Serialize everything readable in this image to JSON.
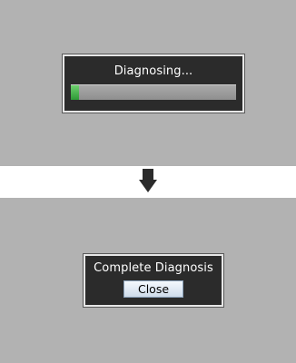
{
  "panels": [
    {
      "title": "Diagnosing...",
      "progress_fraction": 0.05
    },
    {
      "title": "Complete Diagnosis",
      "button_label": "Close"
    }
  ],
  "arrow_icon": "down-arrow-icon",
  "colors": {
    "screen_background": "#b2b2b2",
    "dialog_background": "#2b2b2b",
    "progress_fill": "#3fb04a",
    "button_background": "#e4ecf6"
  }
}
